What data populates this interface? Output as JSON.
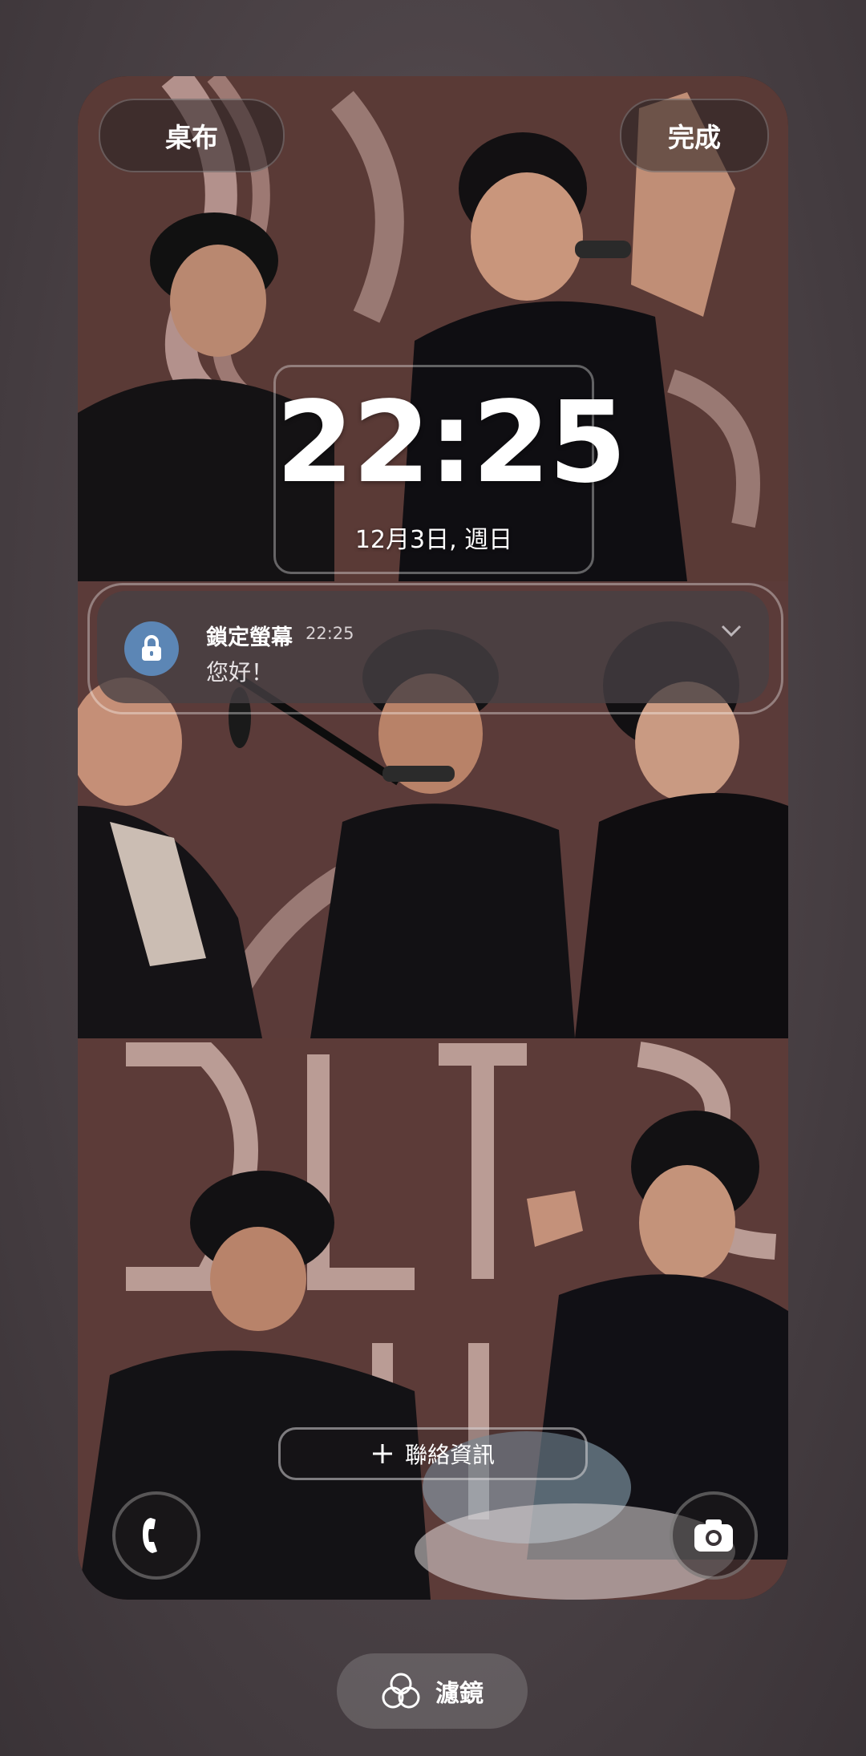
{
  "header": {
    "wallpaper_label": "桌布",
    "done_label": "完成"
  },
  "clock": {
    "time": "22:25",
    "date": "12月3日, 週日"
  },
  "notification": {
    "app_name": "鎖定螢幕",
    "time": "22:25",
    "message": "您好！"
  },
  "shortcuts": {
    "contact_info_label": "聯絡資訊",
    "left_icon": "phone-icon",
    "right_icon": "camera-icon"
  },
  "bottom": {
    "filter_label": "濾鏡",
    "filter_icon": "filter-circles-icon"
  },
  "colors": {
    "notification_icon_bg": "#5c86b5"
  }
}
